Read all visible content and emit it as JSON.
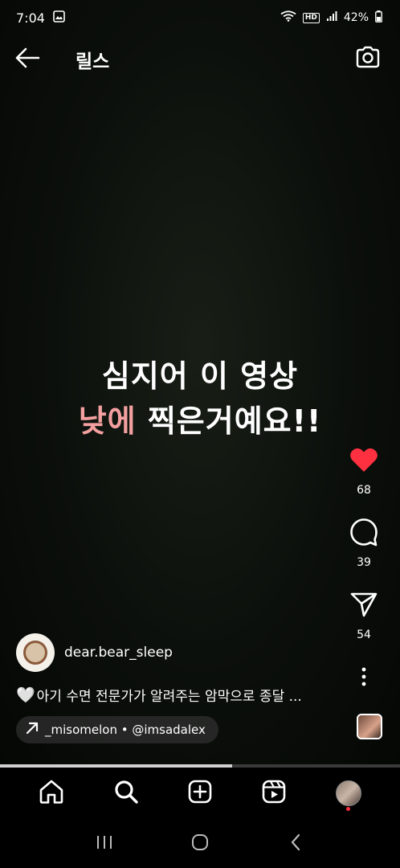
{
  "status_bar": {
    "time": "7:04",
    "battery": "42%",
    "icons": [
      "gallery-icon",
      "wifi-icon",
      "hd-voice-icon",
      "signal-icon",
      "battery-icon"
    ],
    "hd_label": "HD"
  },
  "header": {
    "title": "릴스",
    "back_icon": "arrow-left-icon",
    "camera_icon": "camera-icon"
  },
  "video": {
    "caption_line1": "심지어 이 영상",
    "caption_line2_highlight": "낮에",
    "caption_line2_rest": " 찍은거예요!!",
    "highlight_color": "#f4a0a0"
  },
  "actions": {
    "like_count": "68",
    "comment_count": "39",
    "share_count": "54",
    "like_color": "#ff3040"
  },
  "post": {
    "username": "dear.bear_sleep",
    "description": "아기 수면 전문가가 알려주는 암막으로 종달 ...",
    "description_emoji": "🤍",
    "audio_text": "_misomelon • @imsadalex"
  },
  "playback": {
    "progress": 0.58
  },
  "bottom_nav": {
    "items": [
      "home-icon",
      "search-icon",
      "create-icon",
      "reels-icon",
      "profile-avatar"
    ]
  },
  "system_nav": {
    "items": [
      "recents-icon",
      "home-pill-icon",
      "back-chevron-icon"
    ]
  }
}
